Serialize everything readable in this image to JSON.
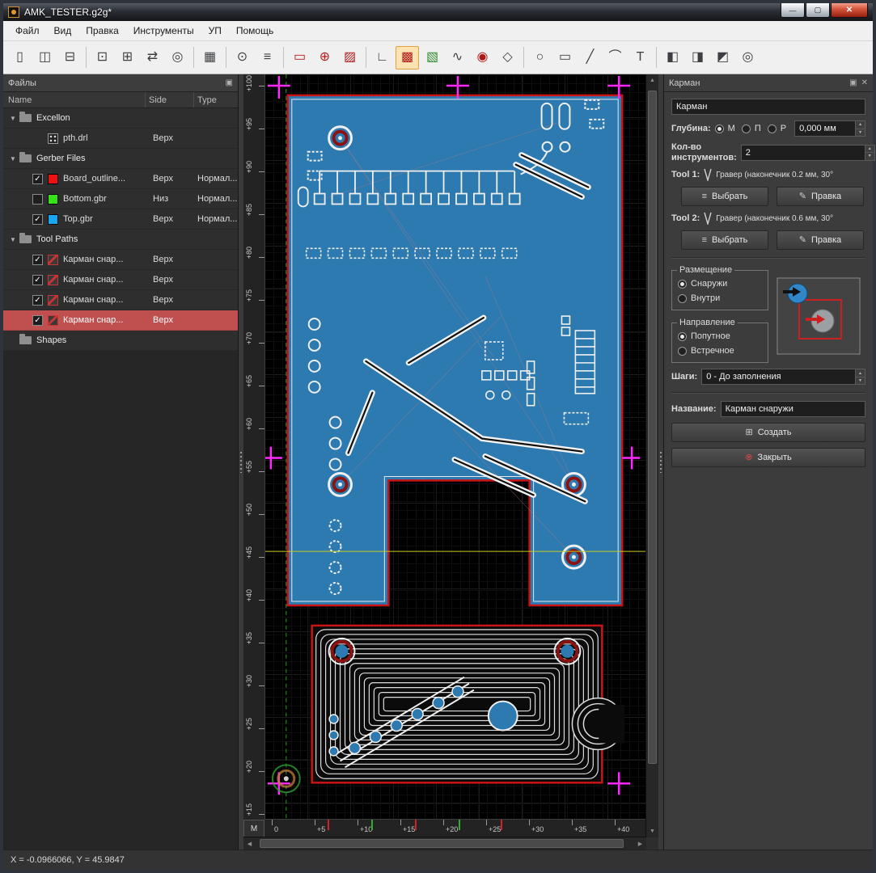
{
  "window": {
    "title": "AMK_TESTER.g2g*"
  },
  "icons": {
    "minimize": "—",
    "maximize": "▢",
    "close": "✕",
    "float_panel": "▣",
    "close_panel": "✕",
    "spin_up": "▲",
    "spin_down": "▼",
    "choose": "≡",
    "edit": "✎",
    "create": "⊞",
    "close_circle": "⊗",
    "group_expanded": "▼"
  },
  "menubar": {
    "items": [
      {
        "name": "file",
        "label": "Файл"
      },
      {
        "name": "view",
        "label": "Вид"
      },
      {
        "name": "edit",
        "label": "Правка"
      },
      {
        "name": "tools",
        "label": "Инструменты"
      },
      {
        "name": "nc-program",
        "label": "УП"
      },
      {
        "name": "help",
        "label": "Помощь"
      }
    ]
  },
  "toolbar": {
    "buttons": [
      {
        "name": "new-project",
        "glyph": "▯"
      },
      {
        "name": "open-project",
        "glyph": "◫"
      },
      {
        "name": "save-project",
        "glyph": "⊟"
      },
      {
        "sep": true
      },
      {
        "name": "select-tool",
        "glyph": "⊡"
      },
      {
        "name": "transform-tool",
        "glyph": "⊞"
      },
      {
        "name": "mirror-tool",
        "glyph": "⇄"
      },
      {
        "name": "rotate-tool",
        "glyph": "◎"
      },
      {
        "sep": true
      },
      {
        "name": "array-copy",
        "glyph": "▦"
      },
      {
        "sep": true
      },
      {
        "name": "machine-settings",
        "glyph": "⊙"
      },
      {
        "name": "gcode-editor",
        "glyph": "≡"
      },
      {
        "sep": true
      },
      {
        "name": "contour-toolpath",
        "glyph": "▭",
        "color": "#b01818"
      },
      {
        "name": "drill-toolpath",
        "glyph": "⊕",
        "color": "#b01818"
      },
      {
        "name": "hatch-toolpath",
        "glyph": "▨",
        "color": "#b01818"
      },
      {
        "sep": true
      },
      {
        "name": "measure-tool",
        "glyph": "∟"
      },
      {
        "name": "pocket-toolpath",
        "glyph": "▩",
        "color": "#b01818",
        "active": true
      },
      {
        "name": "engrave-toolpath",
        "glyph": "▧",
        "color": "#2e8b2e"
      },
      {
        "name": "spline-tool",
        "glyph": "∿"
      },
      {
        "name": "circle-toolpath",
        "glyph": "◉",
        "color": "#b01818"
      },
      {
        "name": "region-select",
        "glyph": "◇"
      },
      {
        "sep": true
      },
      {
        "name": "draw-circle",
        "glyph": "○"
      },
      {
        "name": "draw-rect",
        "glyph": "▭"
      },
      {
        "name": "draw-line",
        "glyph": "╱"
      },
      {
        "name": "draw-arc",
        "glyph": "⌒"
      },
      {
        "name": "draw-text",
        "glyph": "T"
      },
      {
        "sep": true
      },
      {
        "name": "union-shapes",
        "glyph": "◧"
      },
      {
        "name": "subtract-shapes",
        "glyph": "◨"
      },
      {
        "name": "intersect-shapes",
        "glyph": "◩"
      },
      {
        "name": "spiral-tool",
        "glyph": "◎"
      }
    ]
  },
  "files_panel": {
    "title": "Файлы",
    "columns": [
      "Name",
      "Side",
      "Type"
    ],
    "rows": [
      {
        "kind": "group",
        "name": "excellon",
        "label": "Excellon",
        "expanded": true
      },
      {
        "kind": "file",
        "icon": "drill",
        "label": "pth.drl",
        "side": "Верх"
      },
      {
        "kind": "group",
        "name": "gerber-files",
        "label": "Gerber Files",
        "expanded": true
      },
      {
        "kind": "file",
        "swatch": "#ee1111",
        "label": "Board_outline...",
        "side": "Верх",
        "type": "Нормал...",
        "checked": true
      },
      {
        "kind": "file",
        "swatch": "#35e217",
        "label": "Bottom.gbr",
        "side": "Низ",
        "type": "Нормал...",
        "checked": false
      },
      {
        "kind": "file",
        "swatch": "#18a5f2",
        "label": "Top.gbr",
        "side": "Верх",
        "type": "Нормал...",
        "checked": true
      },
      {
        "kind": "group",
        "name": "tool-paths",
        "label": "Tool Paths",
        "expanded": true
      },
      {
        "kind": "file",
        "icon": "toolpath",
        "label": "Карман снар...",
        "side": "Верх",
        "checked": true
      },
      {
        "kind": "file",
        "icon": "toolpath",
        "label": "Карман снар...",
        "side": "Верх",
        "checked": true
      },
      {
        "kind": "file",
        "icon": "toolpath",
        "label": "Карман снар...",
        "side": "Верх",
        "checked": true
      },
      {
        "kind": "file",
        "icon": "toolpath",
        "label": "Карман снар...",
        "side": "Верх",
        "checked": true,
        "selected": true
      },
      {
        "kind": "group",
        "name": "shapes",
        "label": "Shapes",
        "expanded": false
      }
    ]
  },
  "canvas": {
    "unit": "М",
    "v_ruler": [
      "+100",
      "+95",
      "+90",
      "+85",
      "+80",
      "+75",
      "+70",
      "+65",
      "+60",
      "+55",
      "+50",
      "+45",
      "+40",
      "+35",
      "+30",
      "+25",
      "+20",
      "+15"
    ],
    "h_ruler": [
      "0",
      "+5",
      "+10",
      "+15",
      "+20",
      "+25",
      "+30",
      "+35",
      "+40"
    ]
  },
  "pocket_panel": {
    "title": "Карман",
    "name_field": "Карман",
    "depth": {
      "label": "Глубина:",
      "options": [
        "М",
        "П",
        "Р"
      ],
      "selected": "М",
      "value": "0,000 мм"
    },
    "tools_count": {
      "label": "Кол-во инструментов:",
      "value": "2"
    },
    "tool1": {
      "label": "Tool 1:",
      "desc": "Гравер (наконечник 0.2 мм, 30°",
      "choose": "Выбрать",
      "edit": "Правка"
    },
    "tool2": {
      "label": "Tool 2:",
      "desc": "Гравер (наконечник 0.6 мм, 30°",
      "choose": "Выбрать",
      "edit": "Правка"
    },
    "placement": {
      "label": "Размещение",
      "options": [
        "Снаружи",
        "Внутри"
      ],
      "selected": "Снаружи"
    },
    "direction": {
      "label": "Направление",
      "options": [
        "Попутное",
        "Встречное"
      ],
      "selected": "Попутное"
    },
    "steps": {
      "label": "Шаги:",
      "value": "0 - До заполнения"
    },
    "name_row": {
      "label": "Название:",
      "value": "Карман снаружи"
    },
    "create_button": "Создать",
    "close_button": "Закрыть"
  },
  "status": {
    "coords": "X = -0.0966066, Y = 45.9847"
  }
}
